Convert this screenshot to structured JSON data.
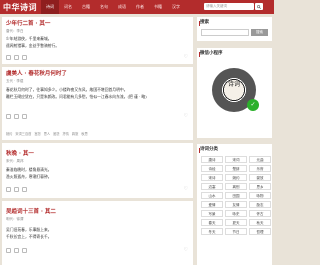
{
  "header": {
    "logo": "中华诗词",
    "nav": [
      "诗词",
      "词名",
      "古籍",
      "名句",
      "成语",
      "作者",
      "书籍",
      "汉字"
    ],
    "active_index": 0,
    "search_placeholder": "请输入关键词"
  },
  "cards": [
    {
      "title": "少年行二首 · 其一",
      "meta": "唐代：李白",
      "lines": [
        "少年结游侠，千里来秦城。",
        "遥闻射猎事，金丝手瞥骑射行。"
      ]
    },
    {
      "title": "虞美人 · 春花秋月何时了",
      "meta": "五代 · 李煜",
      "lines": [
        "春花秋月何时了，往事知多少。小楼昨夜又东风，故国不堪回首月明中。",
        "雕栏玉砌应犹在，只是朱颜改。问君能有几多愁，恰似一江春水向东流。(把 谨 · 略)"
      ],
      "tags": [
        "婉约",
        "宋词三百首",
        "宫怨",
        "思人",
        "闺怨",
        "抒情",
        "羁旅",
        "秋思"
      ]
    },
    {
      "title": "秋晚 · 其一",
      "meta": "宋代：周邦",
      "lines": [
        "秦淮临晚时，楼角悬清光。",
        "渔火照孤舟，寒潮打暮钟。"
      ]
    },
    {
      "title": "吴趋词十三首 · 其二",
      "meta": "明代：徐渭",
      "lines": [
        "吴门旧苑春，乐事殷上来。",
        "千秋长宫上，不得寄长千。"
      ]
    }
  ],
  "sidebar": {
    "search_title": "搜索",
    "search_button": "搜索",
    "qr_title": "微信小程序",
    "qr_center": "诗词",
    "category_title": "诗词分类",
    "categories": [
      "唐诗",
      "宋词",
      "元曲",
      "诗经",
      "楚辞",
      "乐府",
      "宋诗",
      "婉约",
      "豪放",
      "边塞",
      "离别",
      "思乡",
      "山水",
      "田园",
      "咏物",
      "爱情",
      "友情",
      "励志",
      "写景",
      "咏史",
      "怀古",
      "春天",
      "夏天",
      "秋天",
      "冬天",
      "节日",
      "哲理"
    ]
  }
}
